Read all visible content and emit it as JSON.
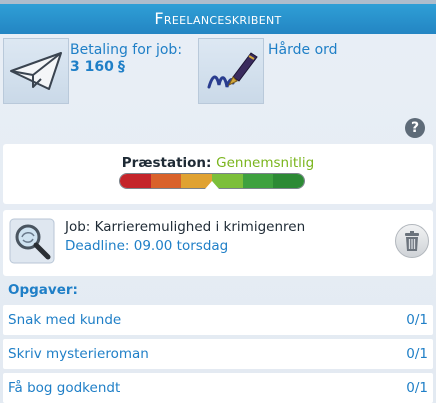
{
  "header": {
    "title": "Freelanceskribent"
  },
  "payment": {
    "label": "Betaling for job:",
    "amount": "3 160",
    "currency_symbol": "§"
  },
  "trait": {
    "label": "Hårde ord"
  },
  "help": {
    "symbol": "?"
  },
  "performance": {
    "label": "Præstation:",
    "value": "Gennemsnitlig",
    "level_fraction": 0.5,
    "segment_colors": [
      "#c4242a",
      "#d9622b",
      "#e0a232",
      "#7cbf3a",
      "#3ea13f",
      "#2c8a35"
    ]
  },
  "job": {
    "title": "Job: Karrieremulighed i krimigenren",
    "deadline": "Deadline: 09.00 torsdag"
  },
  "tasks": {
    "header": "Opgaver:",
    "items": [
      {
        "label": "Snak med kunde",
        "count": "0/1"
      },
      {
        "label": "Skriv mysterieroman",
        "count": "0/1"
      },
      {
        "label": "Få bog godkendt",
        "count": "0/1"
      }
    ]
  },
  "icons": [
    "paper-plane-icon",
    "fountain-pen-icon",
    "help-icon",
    "magnifying-glass-icon",
    "trash-icon"
  ],
  "colors": {
    "header_blue": "#2590cc",
    "accent_blue": "#1f7fc7",
    "good_green": "#7ab51d"
  }
}
